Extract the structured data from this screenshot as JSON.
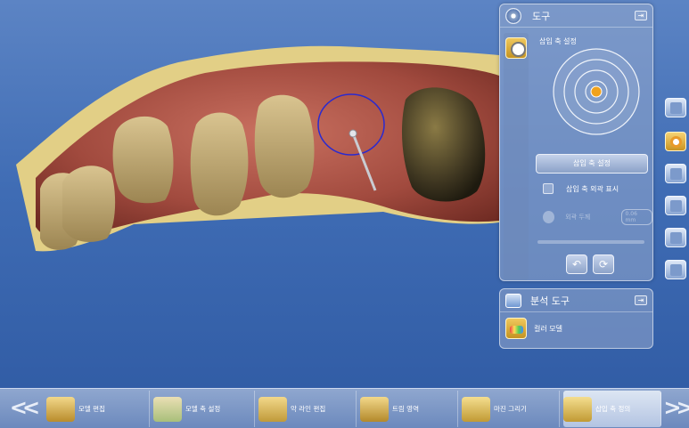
{
  "tool_panel": {
    "title": "도구",
    "pin_label": "⇥",
    "section_label": "삽입 축 설정",
    "set_button_label": "삽입 축 설정",
    "checkbox_label": "삽입 축 외곽 표시",
    "checkbox_checked": false,
    "disabled_label": "외곽 두께",
    "disabled_value": "0.06 mm",
    "undo_icon": "undo-icon",
    "reset_icon": "reset-icon"
  },
  "analysis_panel": {
    "title": "분석 도구",
    "pin_label": "⇥",
    "item_label": "컬러 모델"
  },
  "right_toolbar": [
    {
      "name": "view-cube-icon",
      "active": false
    },
    {
      "name": "insertion-axis-icon",
      "active": true
    },
    {
      "name": "camera-icon",
      "active": false
    },
    {
      "name": "analysis-icon",
      "active": false
    },
    {
      "name": "tool-icon",
      "active": false
    },
    {
      "name": "library-icon",
      "active": false
    }
  ],
  "workflow": {
    "prev_label": "<<",
    "next_label": ">>",
    "steps": [
      {
        "label": "모델 편집",
        "icon": "model-edit-icon",
        "active": false
      },
      {
        "label": "모델 축 설정",
        "icon": "model-axis-icon",
        "active": false
      },
      {
        "label": "악 라인 편집",
        "icon": "arch-line-icon",
        "active": false
      },
      {
        "label": "트림 영역",
        "icon": "trim-area-icon",
        "active": false
      },
      {
        "label": "마진 그리기",
        "icon": "margin-draw-icon",
        "active": false
      },
      {
        "label": "삽입 축 정의",
        "icon": "insertion-axis-define-icon",
        "active": true
      }
    ]
  },
  "colors": {
    "background": "#3f6cb4",
    "accent": "#e3a93a",
    "selection_outline": "#2a2ad0"
  }
}
